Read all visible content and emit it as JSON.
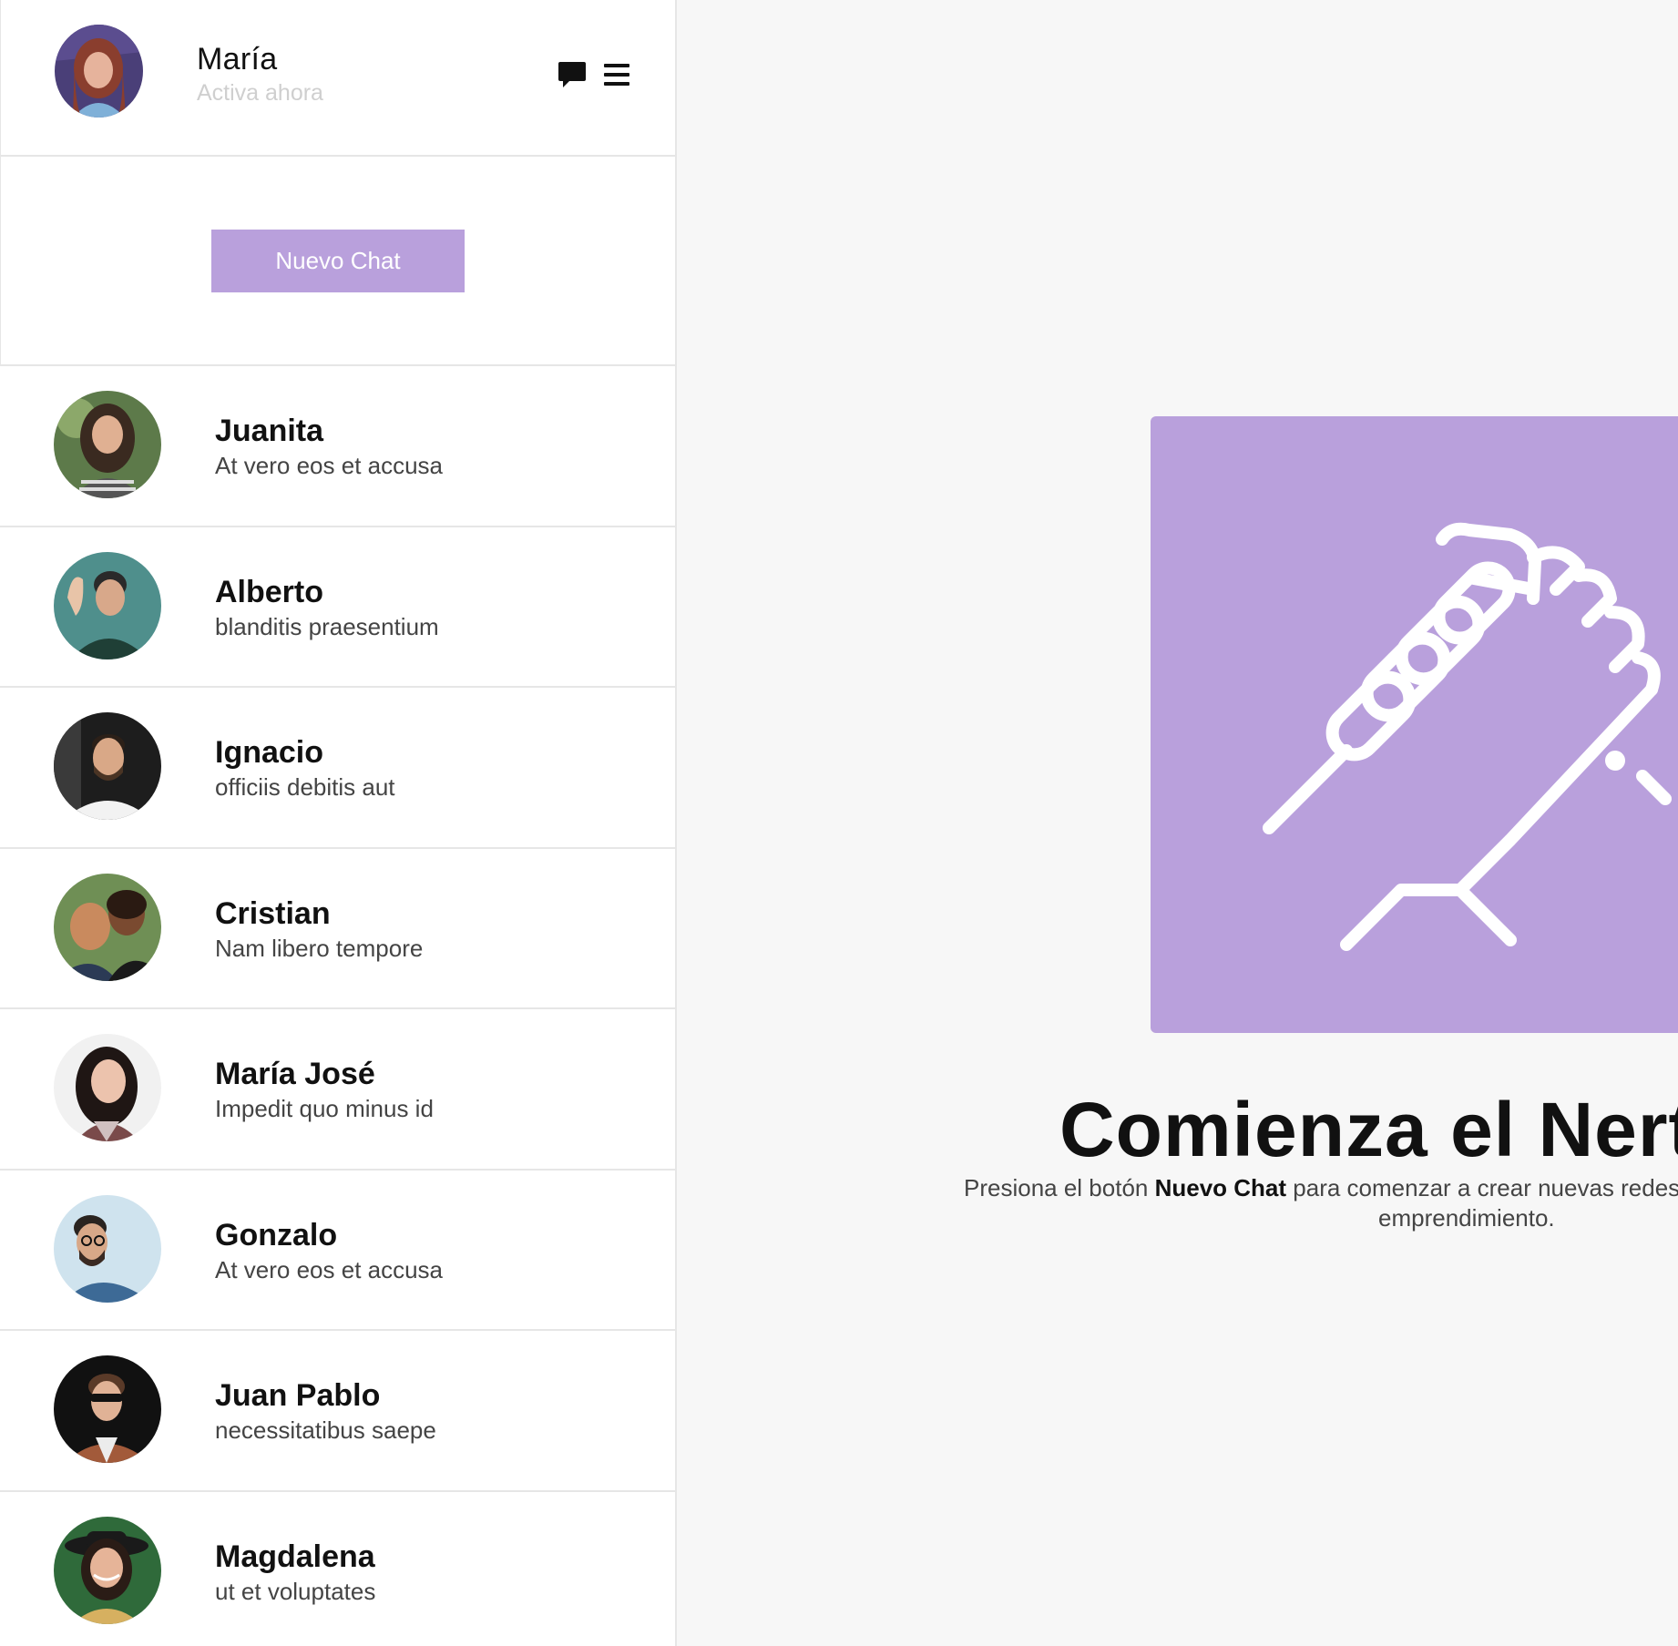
{
  "profile": {
    "name": "María",
    "status": "Activa ahora"
  },
  "sidebar": {
    "new_chat_label": "Nuevo Chat",
    "contacts": [
      {
        "name": "Juanita",
        "preview": "At vero eos et accusa"
      },
      {
        "name": "Alberto",
        "preview": "blanditis praesentium"
      },
      {
        "name": "Ignacio",
        "preview": "officiis debitis aut"
      },
      {
        "name": "Cristian",
        "preview": "Nam libero tempore"
      },
      {
        "name": "María José",
        "preview": "Impedit quo minus id"
      },
      {
        "name": "Gonzalo",
        "preview": "At vero eos et accusa"
      },
      {
        "name": "Juan Pablo",
        "preview": "necessitatibus saepe"
      },
      {
        "name": "Magdalena",
        "preview": "ut et voluptates"
      }
    ]
  },
  "main": {
    "title": "Comienza el Nertwo",
    "desc_before": "Presiona el botón ",
    "desc_bold": "Nuevo Chat",
    "desc_after": " para comenzar a crear nuevas redes de",
    "desc_line2": "emprendimiento."
  },
  "icons": {
    "chat": "chat-bubble-icon",
    "menu": "hamburger-menu-icon",
    "hero": "handshake-icon"
  },
  "colors": {
    "accent": "#b9a0dc",
    "background": "#f7f7f7",
    "sidebar": "#ffffff",
    "divider": "#e6e6e6"
  }
}
